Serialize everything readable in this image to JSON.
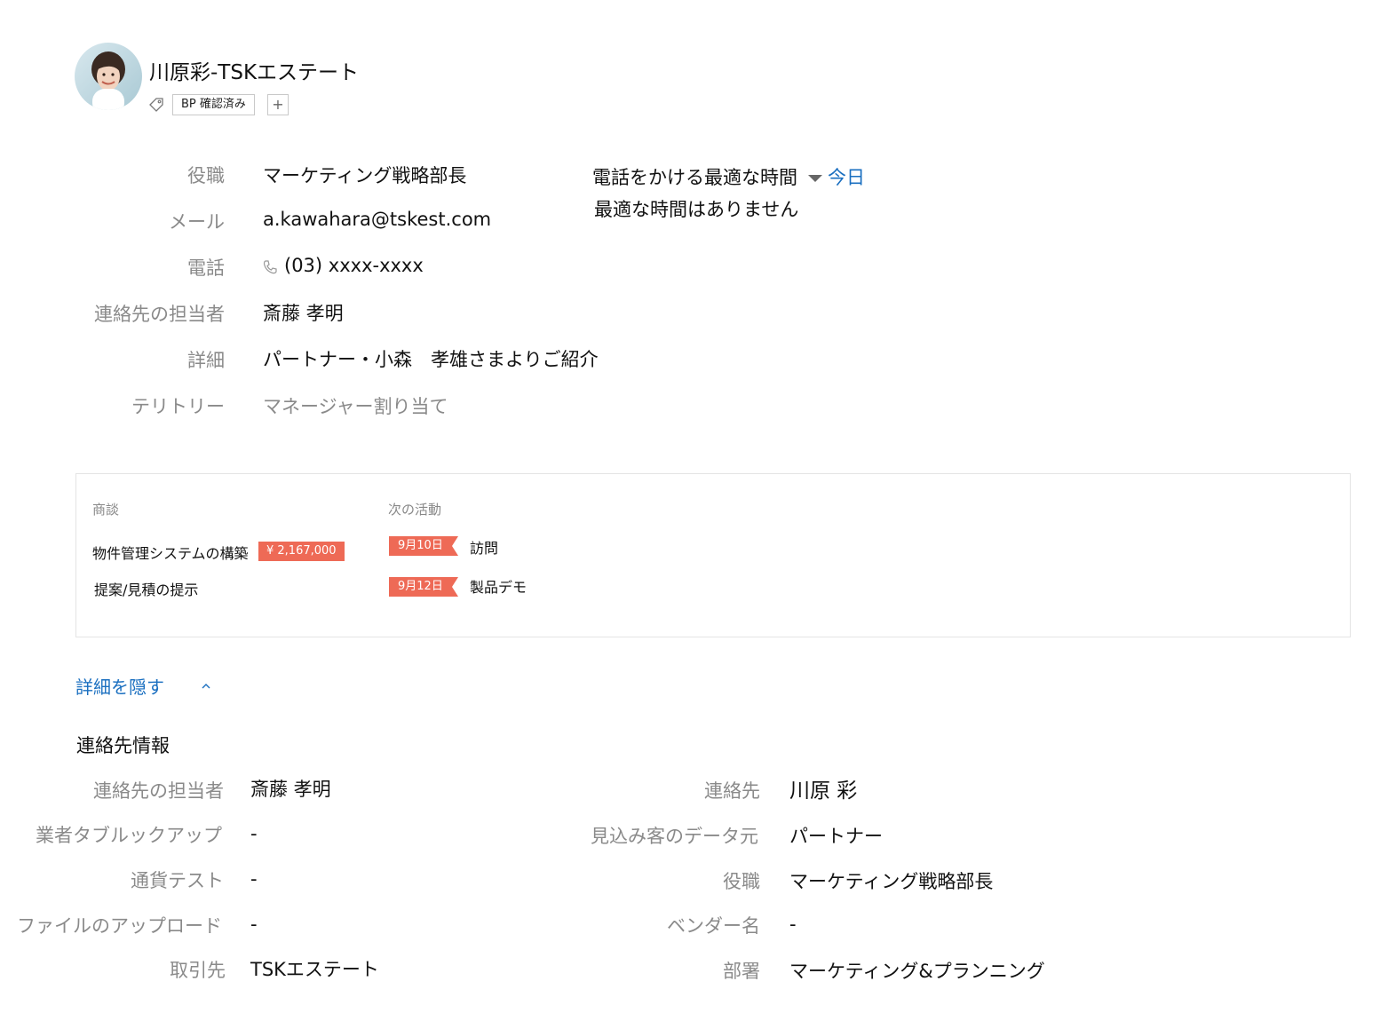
{
  "header": {
    "title": "川原彩-TSKエステート",
    "tag": "BP 確認済み",
    "tag_add": "+"
  },
  "overview": {
    "fields": [
      {
        "label": "役職",
        "value": "マーケティング戦略部長"
      },
      {
        "label": "メール",
        "value": "a.kawahara@tskest.com"
      },
      {
        "label": "電話",
        "value": "(03) xxxx-xxxx"
      },
      {
        "label": "連絡先の担当者",
        "value": "斎藤 孝明"
      },
      {
        "label": "詳細",
        "value": "パートナー・小森　孝雄さまよりご紹介"
      },
      {
        "label": "テリトリー",
        "value": "マネージャー割り当て"
      }
    ],
    "best_time_label": "電話をかける最適な時間",
    "best_time_filter": "今日",
    "best_time_empty": "最適な時間はありません"
  },
  "summary": {
    "deals_heading": "商談",
    "deals": [
      {
        "name": "物件管理システムの構築",
        "amount": "¥ 2,167,000"
      },
      {
        "name": "提案/見積の提示",
        "amount": ""
      }
    ],
    "activities_heading": "次の活動",
    "activities": [
      {
        "date": "9月10日",
        "name": "訪問"
      },
      {
        "date": "9月12日",
        "name": "製品デモ"
      }
    ],
    "accent_color": "#ee6a56"
  },
  "toggle": {
    "label": "詳細を隠す"
  },
  "details": {
    "section_title": "連絡先情報",
    "left": [
      {
        "label": "連絡先の担当者",
        "value": "斎藤 孝明"
      },
      {
        "label": "業者タブルックアップ",
        "value": "-"
      },
      {
        "label": "通貨テスト",
        "value": "-"
      },
      {
        "label": "ファイルのアップロード",
        "value": "-"
      },
      {
        "label": "取引先",
        "value": "TSKエステート"
      }
    ],
    "right": [
      {
        "label": "連絡先",
        "value": "川原 彩"
      },
      {
        "label": "見込み客のデータ元",
        "value": "パートナー"
      },
      {
        "label": "役職",
        "value": "マーケティング戦略部長"
      },
      {
        "label": "ベンダー名",
        "value": "-"
      },
      {
        "label": "部署",
        "value": "マーケティング&プランニング"
      }
    ]
  },
  "icons": {
    "tag": "tag-icon",
    "phone": "phone-icon",
    "dropdown": "caret-down-icon",
    "collapse": "chevron-up-icon"
  },
  "link_color": "#1a6fc0"
}
